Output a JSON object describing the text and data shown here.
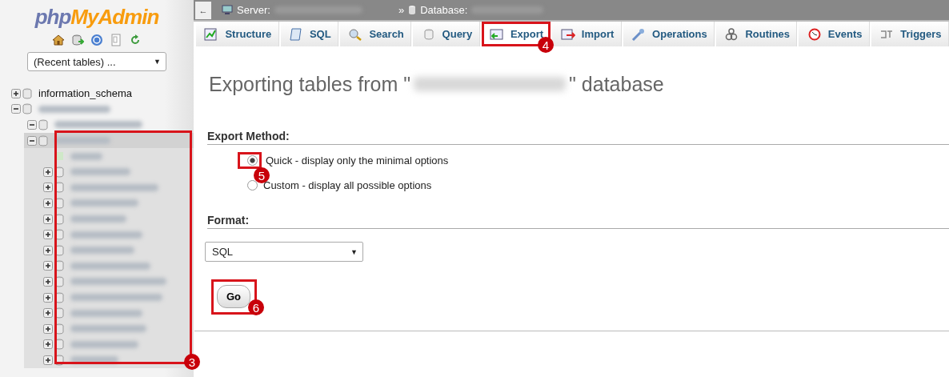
{
  "sidebar": {
    "logo": {
      "part1": "php",
      "part2": "MyAdmin"
    },
    "recent_tables": {
      "value": "(Recent tables) ...",
      "arrow": "▼"
    },
    "tree": [
      {
        "kind": "text",
        "label": "information_schema",
        "expanded": false,
        "selected": false
      },
      {
        "kind": "redacted",
        "expanded": true,
        "selected": false,
        "children": [
          {
            "kind": "redacted",
            "expanded": true,
            "selected": false
          },
          {
            "kind": "redacted",
            "expanded": true,
            "selected": true,
            "children": [
              {
                "kind": "new"
              },
              {
                "kind": "redacted",
                "expanded": false
              },
              {
                "kind": "redacted",
                "expanded": false
              },
              {
                "kind": "redacted",
                "expanded": false
              },
              {
                "kind": "redacted",
                "expanded": false
              },
              {
                "kind": "redacted",
                "expanded": false
              },
              {
                "kind": "redacted",
                "expanded": false
              },
              {
                "kind": "redacted",
                "expanded": false
              },
              {
                "kind": "redacted",
                "expanded": false
              },
              {
                "kind": "redacted",
                "expanded": false
              },
              {
                "kind": "redacted",
                "expanded": false
              },
              {
                "kind": "redacted",
                "expanded": false
              },
              {
                "kind": "redacted",
                "expanded": false
              },
              {
                "kind": "redacted",
                "expanded": false
              }
            ]
          }
        ]
      }
    ]
  },
  "breadcrumb": {
    "back": "←",
    "server": "Server:",
    "separator": "»",
    "database": "Database:"
  },
  "tabs": [
    {
      "label": "Structure",
      "selected": false,
      "highlighted": false
    },
    {
      "label": "SQL",
      "selected": false,
      "highlighted": false
    },
    {
      "label": "Search",
      "selected": false,
      "highlighted": false
    },
    {
      "label": "Query",
      "selected": false,
      "highlighted": false
    },
    {
      "label": "Export",
      "selected": true,
      "highlighted": true
    },
    {
      "label": "Import",
      "selected": false,
      "highlighted": false
    },
    {
      "label": "Operations",
      "selected": false,
      "highlighted": false
    },
    {
      "label": "Routines",
      "selected": false,
      "highlighted": false
    },
    {
      "label": "Events",
      "selected": false,
      "highlighted": false
    },
    {
      "label": "Triggers",
      "selected": false,
      "highlighted": false
    }
  ],
  "page": {
    "title_start": "Exporting tables from \"",
    "title_end": "\" database",
    "export_method": {
      "heading": "Export Method:",
      "options": [
        {
          "label": "Quick - display only the minimal options",
          "selected": true,
          "highlighted": true
        },
        {
          "label": "Custom - display all possible options",
          "selected": false,
          "highlighted": false
        }
      ]
    },
    "format": {
      "heading": "Format:",
      "value": "SQL",
      "arrow": "▼"
    },
    "go_button": {
      "label": "Go",
      "highlighted": true
    }
  },
  "callouts": [
    {
      "number": "3"
    },
    {
      "number": "4"
    },
    {
      "number": "5"
    },
    {
      "number": "6"
    }
  ]
}
